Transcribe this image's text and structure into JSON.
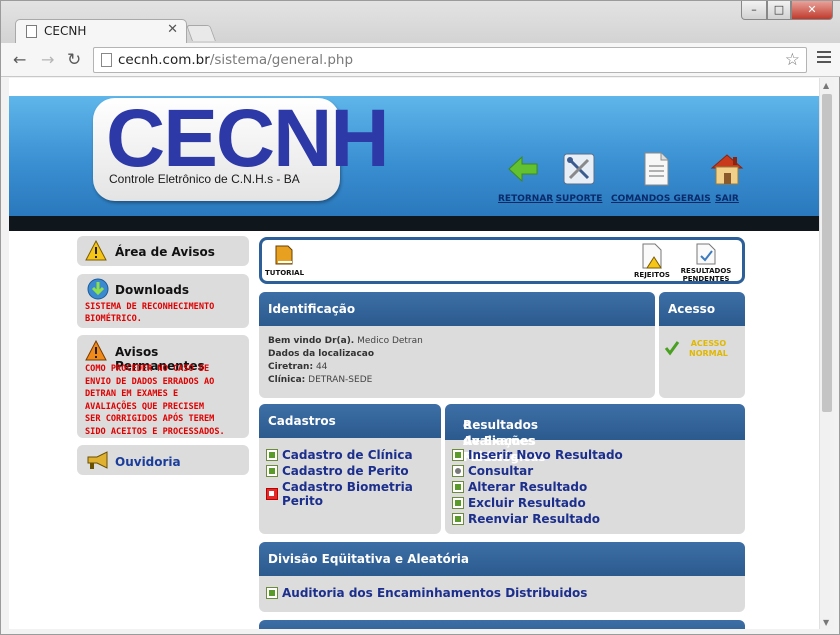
{
  "browser": {
    "tab_title": "CECNH",
    "url_domain": "cecnh.com.br",
    "url_path": "/sistema/general.php",
    "window_buttons": [
      "–",
      "□",
      "✕"
    ]
  },
  "header": {
    "logo_text": "CECNH",
    "logo_subtitle": "Controle Eletrônico de C.N.H.s - BA",
    "nav": [
      {
        "label": "RETORNAR",
        "icon": "arrow-left-icon"
      },
      {
        "label": "SUPORTE",
        "icon": "tools-icon"
      },
      {
        "label": "COMANDOS GERAIS",
        "icon": "document-icon"
      },
      {
        "label": "SAIR",
        "icon": "home-icon"
      }
    ]
  },
  "sidebar": {
    "avisos_title": "Área de Avisos",
    "downloads_title": "Downloads",
    "downloads_text_1": "SISTEMA DE RECONHECIMENTO",
    "downloads_text_2": "BIOMÉTRICO.",
    "permanentes_title": "Avisos Permanentes",
    "permanentes_lines": [
      "COMO PROCEDER NO CASO DE",
      "ENVIO DE DADOS ERRADOS AO",
      "DETRAN EM EXAMES E",
      "AVALIAÇÕES QUE PRECISEM",
      "SER CORRIGIDOS APÓS TEREM",
      "SIDO ACEITOS E PROCESSADOS."
    ],
    "ouvidoria_label": "Ouvidoria"
  },
  "quickbar": {
    "tutorial": "TUTORIAL",
    "rejeitos": "REJEITOS",
    "resultados_1": "RESULTADOS",
    "resultados_2": "PENDENTES"
  },
  "identificacao": {
    "title": "Identificação",
    "welcome_label": "Bem vindo Dr(a).",
    "welcome_value": "Medico Detran",
    "location_label": "Dados da localizacao",
    "ciretran_label": "Ciretran:",
    "ciretran_value": "44",
    "clinica_label": "Clínica:",
    "clinica_value": "DETRAN-SEDE"
  },
  "acesso": {
    "title": "Acesso",
    "status_1": "ACESSO",
    "status_2": "NORMAL"
  },
  "cadastros": {
    "title": "Cadastros",
    "links": [
      "Cadastro de Clínica",
      "Cadastro de Perito",
      "Cadastro Biometria Perito"
    ]
  },
  "resultados": {
    "title_1": "Resultados de Exames Médicos",
    "title_2": "e Avaliações Psicológicas",
    "links": [
      "Inserir Novo Resultado",
      "Consultar",
      "Alterar Resultado",
      "Excluir Resultado",
      "Reenviar Resultado"
    ]
  },
  "divisao": {
    "title": "Divisão Eqüitativa e Aleatória",
    "link": "Auditoria dos Encaminhamentos Distribuidos"
  },
  "colors": {
    "panel_header": "#2b5a8e",
    "link": "#1c2f8c",
    "warning_red": "#e00000",
    "status_yellow": "#e1b800"
  }
}
